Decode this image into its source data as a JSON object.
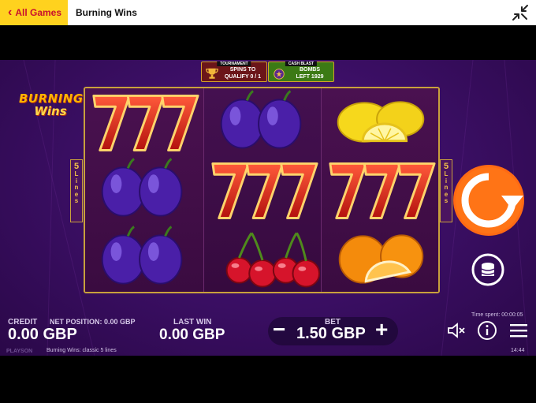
{
  "topbar": {
    "back_label": "All Games",
    "title": "Burning Wins",
    "icons": {
      "back": "chevron-left-icon",
      "collapse": "collapse-fullscreen-icon"
    }
  },
  "game": {
    "logo": {
      "line1": "BURNING",
      "line2": "Wins"
    },
    "tournament": {
      "tag": "TOURNAMENT",
      "line1": "SPINS TO",
      "line2": "QUALIFY 0 / 1"
    },
    "cash_blast": {
      "tag": "CASH BLAST",
      "line1": "BOMBS",
      "line2": "LEFT 1929"
    },
    "lines": {
      "count": "5",
      "word": [
        "L",
        "i",
        "n",
        "e",
        "s"
      ]
    },
    "reels": [
      [
        "seven",
        "plum",
        "plum"
      ],
      [
        "plum",
        "seven",
        "cherry"
      ],
      [
        "lemon",
        "seven",
        "orange"
      ]
    ]
  },
  "bottom": {
    "credit_label": "CREDIT",
    "credit_value": "0.00 GBP",
    "net_label": "NET POSITION: 0.00 GBP",
    "lastwin_label": "LAST WIN",
    "lastwin_value": "0.00 GBP",
    "bet_label": "BET",
    "bet_value": "1.50 GBP",
    "minus": "−",
    "plus": "+",
    "time_spent": "Time spent: 00:00:05",
    "clock": "14:44",
    "provider": "PLAYSON",
    "game_info": "Burning Wins: classic 5 lines"
  },
  "colors": {
    "accent_yellow": "#ffd21e",
    "spin_orange": "#ff6a13",
    "frame_gold": "#c9a13c",
    "bg_purple": "#3c0f66"
  }
}
